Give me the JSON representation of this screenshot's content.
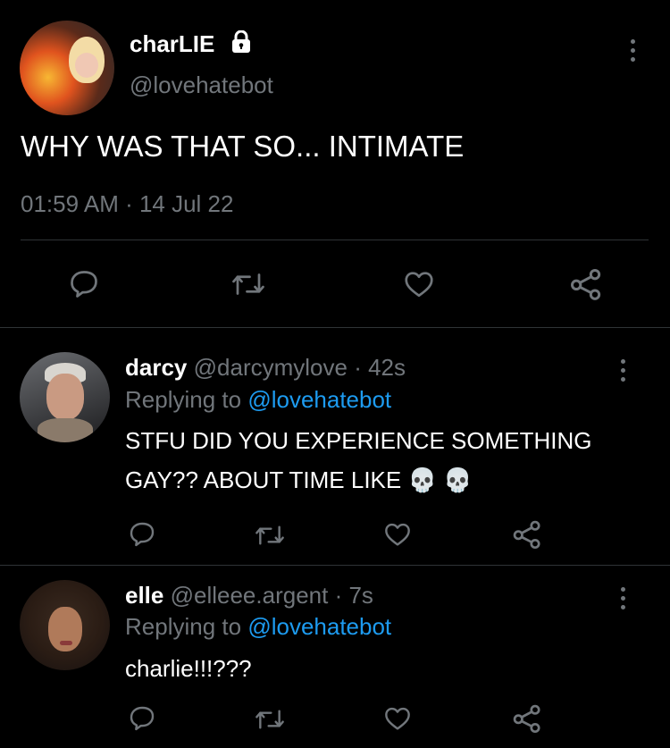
{
  "main_tweet": {
    "display_name": "charLIE",
    "handle": "@lovehatebot",
    "text": "WHY WAS THAT SO... INTIMATE",
    "timestamp": "01:59 AM · 14 Jul 22",
    "protected_icon": "lock-icon",
    "actions": [
      "reply-icon",
      "retweet-icon",
      "like-icon",
      "share-icon"
    ]
  },
  "replies": [
    {
      "display_name": "darcy",
      "handle": "@darcymylove",
      "age": "· 42s",
      "replying_prefix": "Replying to",
      "replying_handle": "@lovehatebot",
      "text_line1": "STFU DID YOU EXPERIENCE SOMETHING",
      "text_line2": "GAY?? ABOUT TIME LIKE 💀 💀"
    },
    {
      "display_name": "elle",
      "handle": "@elleee.argent",
      "age": "· 7s",
      "replying_prefix": "Replying to",
      "replying_handle": "@lovehatebot",
      "text_line1": "charlie!!!???"
    }
  ],
  "colors": {
    "background": "#000000",
    "muted": "#71767b",
    "link": "#1d9bf0",
    "divider": "#2f3336"
  }
}
